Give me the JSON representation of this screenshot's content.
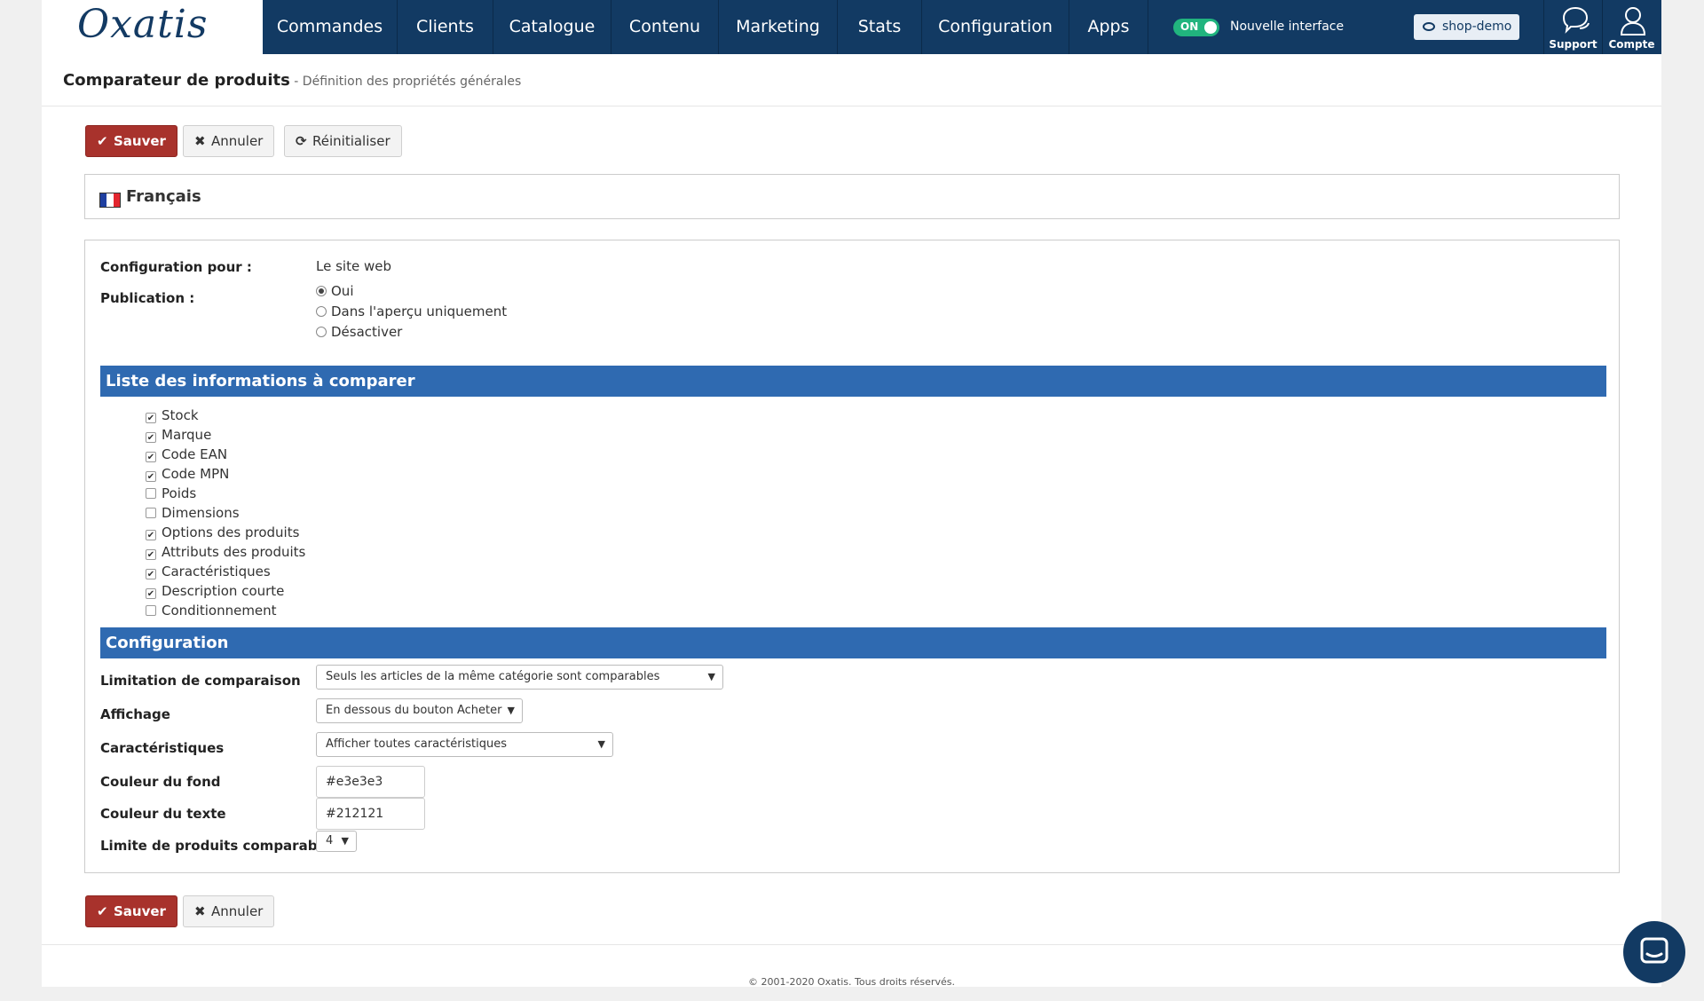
{
  "brand": {
    "logo_text": "Oxatis"
  },
  "nav": {
    "items": [
      "Commandes",
      "Clients",
      "Catalogue",
      "Contenu",
      "Marketing",
      "Stats",
      "Configuration",
      "Apps"
    ],
    "toggle_state": "ON",
    "toggle_label": "Nouvelle interface",
    "shop_label": "shop-demo",
    "support_label": "Support",
    "account_label": "Compte"
  },
  "header": {
    "title": "Comparateur de produits",
    "subtitle": " - Définition des propriétés générales"
  },
  "toolbar": {
    "save_label": "Sauver",
    "cancel_label": "Annuler",
    "reset_label": "Réinitialiser"
  },
  "language": {
    "label": "Français"
  },
  "general": {
    "config_for_label": "Configuration pour :",
    "config_for_value": "Le site web",
    "publication_label": "Publication :",
    "publication_options": [
      {
        "label": "Oui",
        "selected": true
      },
      {
        "label": "Dans l'aperçu uniquement",
        "selected": false
      },
      {
        "label": "Désactiver",
        "selected": false
      }
    ]
  },
  "compare_section": {
    "title": "Liste des informations à comparer",
    "items": [
      {
        "label": "Stock",
        "checked": true
      },
      {
        "label": "Marque",
        "checked": true
      },
      {
        "label": "Code EAN",
        "checked": true
      },
      {
        "label": "Code MPN",
        "checked": true
      },
      {
        "label": "Poids",
        "checked": false
      },
      {
        "label": "Dimensions",
        "checked": false
      },
      {
        "label": "Options des produits",
        "checked": true
      },
      {
        "label": "Attributs des produits",
        "checked": true
      },
      {
        "label": "Caractéristiques",
        "checked": true
      },
      {
        "label": "Description courte",
        "checked": true
      },
      {
        "label": "Conditionnement",
        "checked": false
      }
    ]
  },
  "config_section": {
    "title": "Configuration",
    "limitation_label": "Limitation de comparaison",
    "limitation_value": "Seuls les articles de la même catégorie sont comparables",
    "affichage_label": "Affichage",
    "affichage_value": "En dessous du bouton Acheter",
    "caracteristiques_label": "Caractéristiques",
    "caracteristiques_value": "Afficher toutes caractéristiques",
    "bg_color_label": "Couleur du fond",
    "bg_color_value": "#e3e3e3",
    "text_color_label": "Couleur du texte",
    "text_color_value": "#212121",
    "limit_label": "Limite de produits comparables",
    "limit_value": "4"
  },
  "footer": {
    "copyright": "© 2001-2020 Oxatis. Tous droits réservés."
  },
  "colors": {
    "nav_bg": "#123a63",
    "accent_red": "#a8322c",
    "section_blue": "#2f6ab1",
    "toggle_green": "#21b47e"
  }
}
